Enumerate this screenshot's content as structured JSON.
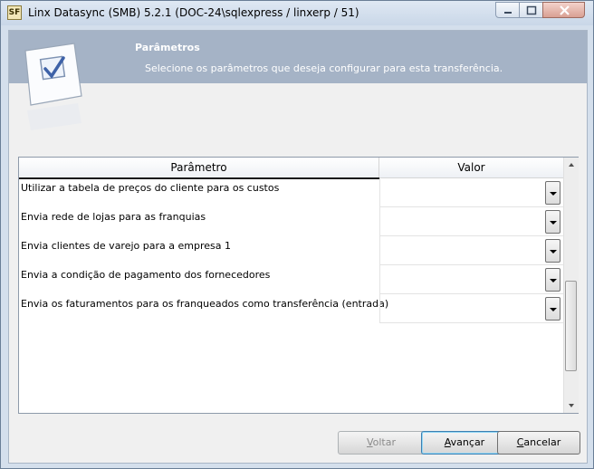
{
  "window": {
    "title": "Linx Datasync (SMB) 5.2.1 (DOC-24\\sqlexpress / linxerp / 51)",
    "app_icon": "SF"
  },
  "header": {
    "title": "Parâmetros",
    "subtitle": "Selecione os parâmetros que deseja configurar para esta transferência."
  },
  "grid": {
    "columns": [
      "Parâmetro",
      "Valor"
    ],
    "rows": [
      {
        "parametro": "Utilizar a tabela de preços do cliente para os custos",
        "valor": ""
      },
      {
        "parametro": "Envia rede de lojas para as franquias",
        "valor": ""
      },
      {
        "parametro": "Envia clientes de varejo para a empresa 1",
        "valor": ""
      },
      {
        "parametro": "Envia a condição de pagamento dos fornecedores",
        "valor": ""
      },
      {
        "parametro": "Envia os faturamentos para os franqueados como transferência (entrada)",
        "valor": ""
      }
    ]
  },
  "buttons": {
    "voltar": {
      "access": "V",
      "rest": "oltar"
    },
    "avancar": {
      "access": "A",
      "rest": "vançar"
    },
    "cancelar": {
      "access": "C",
      "rest": "ancelar"
    }
  },
  "colors": {
    "header_band": "#a5b3c6",
    "window_frame": "#d4dfec"
  }
}
